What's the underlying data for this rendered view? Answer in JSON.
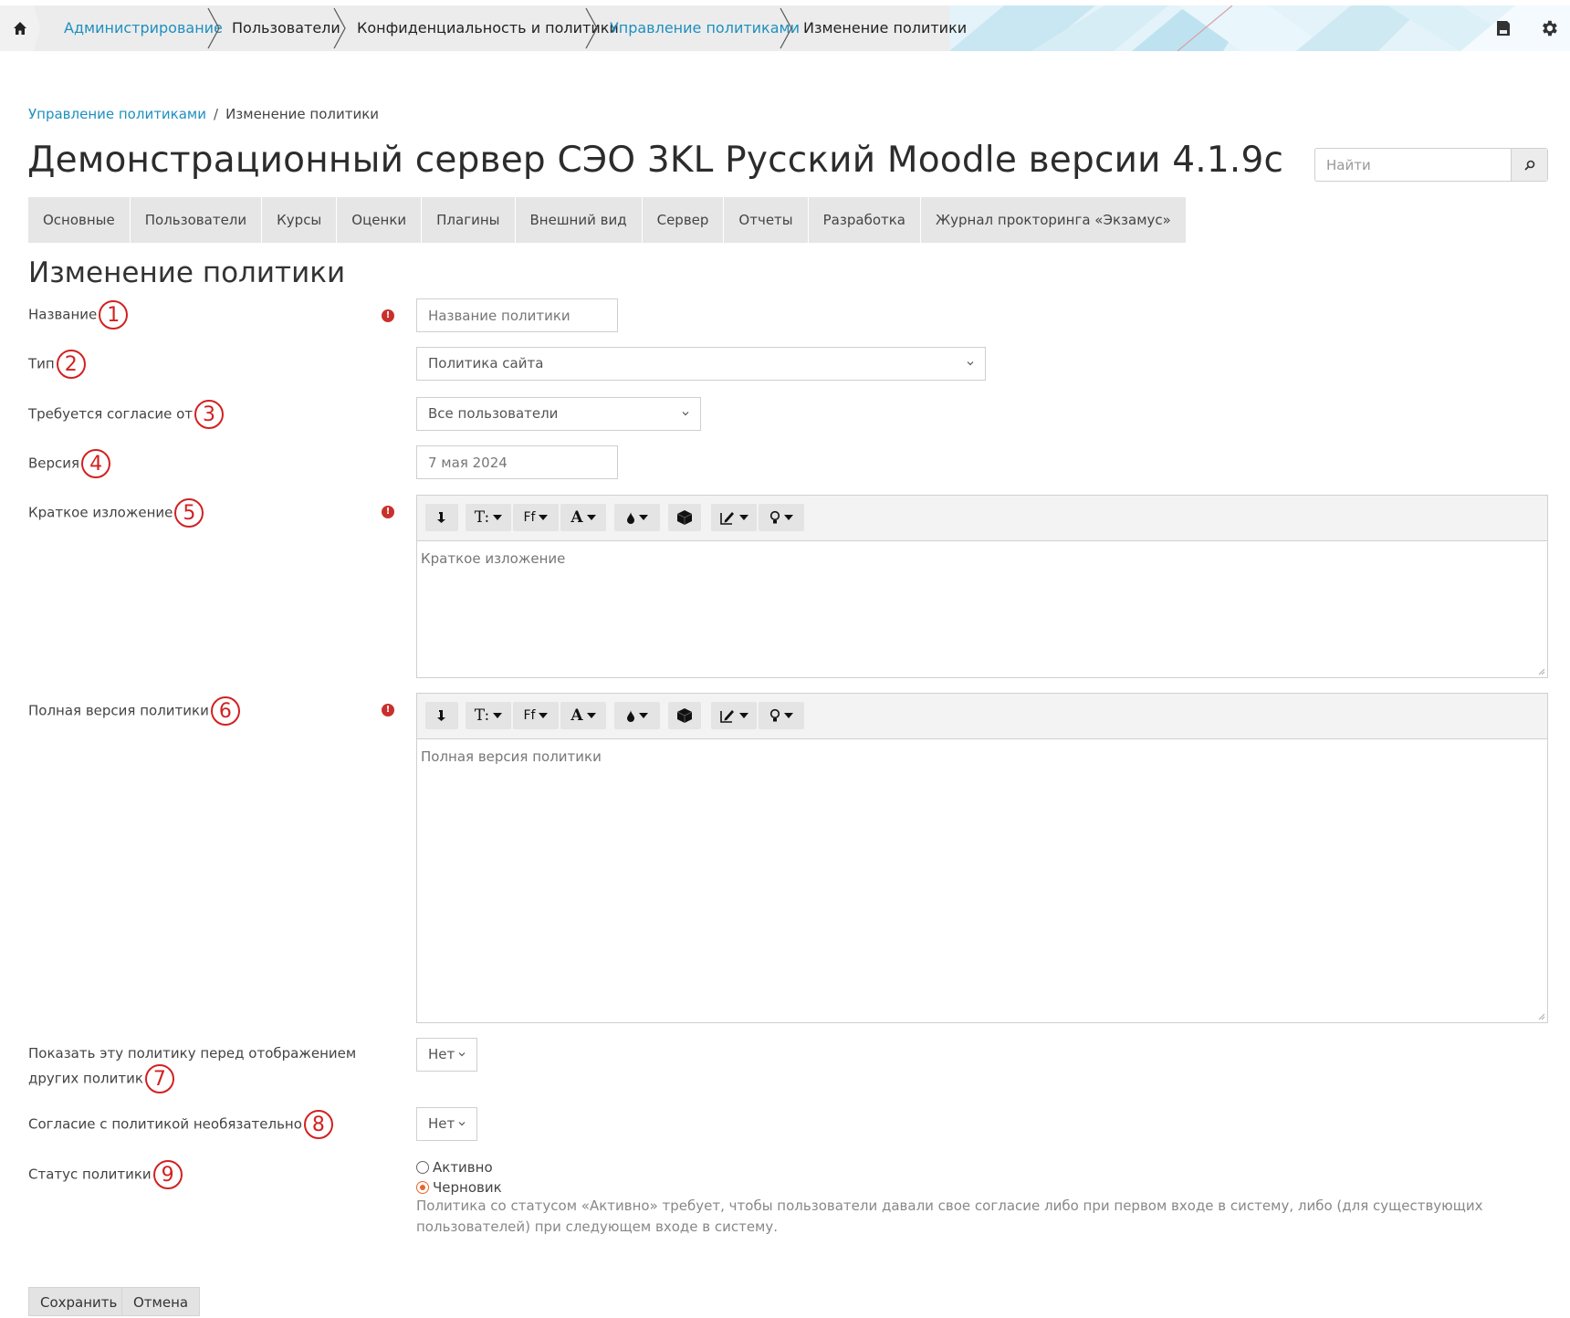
{
  "topnav": {
    "home_icon": "home-icon",
    "breadcrumbs": [
      {
        "label": "Администрирование",
        "link": true
      },
      {
        "label": "Пользователи",
        "link": false
      },
      {
        "label": "Конфиденциальность и политики",
        "link": false
      },
      {
        "label": "Управление политиками",
        "link": true
      },
      {
        "label": "Изменение политики",
        "link": false
      }
    ],
    "icons": [
      "save-icon",
      "gear-icon"
    ]
  },
  "page_breadcrumb": {
    "link": "Управление политиками",
    "separator": "/",
    "current": "Изменение политики"
  },
  "page_title": "Демонстрационный сервер СЭО 3KL Русский Moodle версии 4.1.9c",
  "search": {
    "placeholder": "Найти"
  },
  "tabs": [
    "Основные",
    "Пользователи",
    "Курсы",
    "Оценки",
    "Плагины",
    "Внешний вид",
    "Сервер",
    "Отчеты",
    "Разработка",
    "Журнал прокторинга «Экзамус»"
  ],
  "section_title": "Изменение политики",
  "form": {
    "name": {
      "label": "Название",
      "marker": "1",
      "placeholder": "Название политики",
      "required": true
    },
    "type": {
      "label": "Тип",
      "marker": "2",
      "value": "Политика сайта"
    },
    "consent": {
      "label": "Требуется согласие от",
      "marker": "3",
      "value": "Все пользователи"
    },
    "version": {
      "label": "Версия",
      "marker": "4",
      "placeholder": "7 мая 2024"
    },
    "summary": {
      "label": "Краткое изложение",
      "marker": "5",
      "placeholder": "Краткое изложение",
      "required": true
    },
    "content": {
      "label": "Полная версия политики",
      "marker": "6",
      "placeholder": "Полная версия политики",
      "required": true
    },
    "show_first": {
      "label": "Показать эту политику перед отображением других политик",
      "marker": "7",
      "value": "Нет"
    },
    "optional": {
      "label": "Согласие с политикой необязательно",
      "marker": "8",
      "value": "Нет"
    },
    "status": {
      "label": "Статус политики",
      "marker": "9",
      "options": [
        {
          "label": "Активно",
          "checked": false
        },
        {
          "label": "Черновик",
          "checked": true
        }
      ],
      "help": "Политика со статусом «Активно» требует, чтобы пользователи давали свое согласие либо при первом входе в систему, либо (для существующих пользователей) при следующем входе в систему."
    }
  },
  "editor_toolbar": [
    "collapse-icon",
    "font-size-icon",
    "font-family-icon",
    "font-color-icon",
    "background-color-icon",
    "cube-icon",
    "edit-icon",
    "lightbulb-icon"
  ],
  "buttons": {
    "save": "Сохранить",
    "cancel": "Отмена"
  },
  "colors": {
    "link": "#1e8fbf",
    "marker": "#d32020",
    "required": "#c9302c",
    "radio_active": "#e8652d"
  }
}
